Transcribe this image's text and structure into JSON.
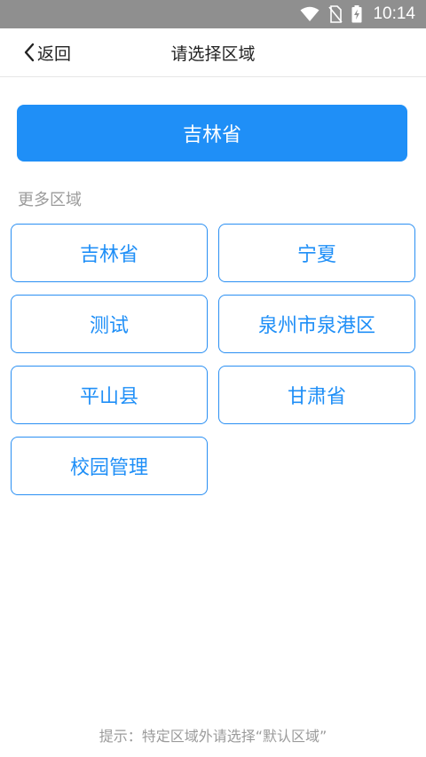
{
  "status_bar": {
    "time": "10:14",
    "icons": [
      "wifi-icon",
      "no-sim-icon",
      "battery-charging-icon"
    ]
  },
  "header": {
    "back_label": "返回",
    "title": "请选择区域"
  },
  "current_region": {
    "label": "吉林省"
  },
  "more_regions": {
    "label": "更多区域",
    "items": [
      {
        "label": "吉林省"
      },
      {
        "label": "宁夏"
      },
      {
        "label": "测试"
      },
      {
        "label": "泉州市泉港区"
      },
      {
        "label": "平山县"
      },
      {
        "label": "甘肃省"
      },
      {
        "label": "校园管理"
      }
    ]
  },
  "hint": "提示：特定区域外请选择“默认区域”",
  "colors": {
    "accent": "#1f8ff7",
    "status_bar": "#8f8f8f",
    "muted_text": "#9b9b9b"
  }
}
